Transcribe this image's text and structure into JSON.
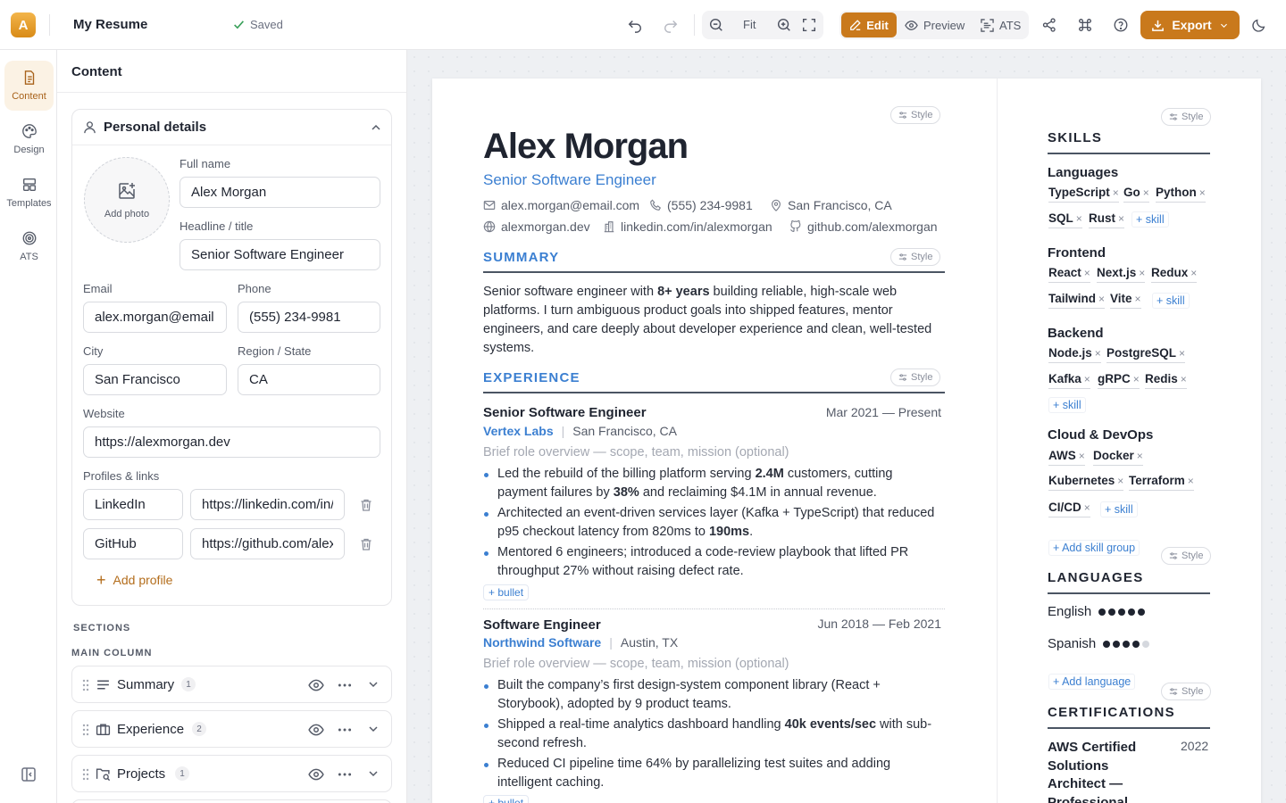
{
  "app": {
    "logo_letter": "A",
    "title": "My Resume",
    "saved_label": "Saved"
  },
  "toolbar": {
    "zoom_fit_label": "Fit",
    "modes": {
      "edit": "Edit",
      "preview": "Preview",
      "ats": "ATS"
    },
    "export_label": "Export",
    "accent": "#c9791c"
  },
  "rail": {
    "items": [
      {
        "label": "Content"
      },
      {
        "label": "Design"
      },
      {
        "label": "Templates"
      },
      {
        "label": "ATS"
      }
    ]
  },
  "panel": {
    "title": "Content",
    "personal": {
      "title": "Personal details",
      "add_photo": "Add photo",
      "full_name": {
        "label": "Full name",
        "value": "Alex Morgan"
      },
      "headline": {
        "label": "Headline / title",
        "value": "Senior Software Engineer"
      },
      "email": {
        "label": "Email",
        "value": "alex.morgan@email.com"
      },
      "phone": {
        "label": "Phone",
        "value": "(555) 234-9981"
      },
      "city": {
        "label": "City",
        "value": "San Francisco"
      },
      "region": {
        "label": "Region / State",
        "value": "CA"
      },
      "website": {
        "label": "Website",
        "value": "https://alexmorgan.dev"
      },
      "profiles_label": "Profiles & links",
      "profiles": [
        {
          "network": "LinkedIn",
          "url": "https://linkedin.com/in/alexmorgan"
        },
        {
          "network": "GitHub",
          "url": "https://github.com/alexmorgan"
        }
      ],
      "add_profile": "Add profile"
    },
    "sections_label": "SECTIONS",
    "main_column_label": "MAIN COLUMN",
    "sections": [
      {
        "name": "Summary",
        "count": "1"
      },
      {
        "name": "Experience",
        "count": "2"
      },
      {
        "name": "Projects",
        "count": "1"
      }
    ]
  },
  "resume": {
    "style_label": "Style",
    "name": "Alex Morgan",
    "headline": "Senior Software Engineer",
    "contact": {
      "email": "alex.morgan@email.com",
      "phone": "(555) 234-9981",
      "location": "San Francisco, CA",
      "website": "alexmorgan.dev",
      "linkedin": "linkedin.com/in/alexmorgan",
      "github": "github.com/alexmorgan"
    },
    "summary": {
      "heading": "SUMMARY",
      "t1": "Senior software engineer with ",
      "b1": "8+ years",
      "t2": " building reliable, high-scale web platforms. I turn ambiguous product goals into shipped features, mentor engineers, and care deeply about developer experience and clean, well-tested systems."
    },
    "experience": {
      "heading": "EXPERIENCE",
      "overview_placeholder": "Brief role overview — scope, team, mission (optional)",
      "add_bullet": "+ bullet",
      "jobs": [
        {
          "title": "Senior Software Engineer",
          "dates": "Mar 2021 — Present",
          "company": "Vertex Labs",
          "location": "San Francisco, CA",
          "b1a": "Led the rebuild of the billing platform serving ",
          "b1b": "2.4M",
          "b1c": " customers, cutting payment failures by ",
          "b1d": "38%",
          "b1e": " and reclaiming $4.1M in annual revenue.",
          "b2a": "Architected an event-driven services layer (Kafka + TypeScript) that reduced p95 checkout latency from 820ms to ",
          "b2b": "190ms",
          "b2c": ".",
          "b3": "Mentored 6 engineers; introduced a code-review playbook that lifted PR throughput 27% without raising defect rate."
        },
        {
          "title": "Software Engineer",
          "dates": "Jun 2018 — Feb 2021",
          "company": "Northwind Software",
          "location": "Austin, TX",
          "b1": "Built the company’s first design-system component library (React + Storybook), adopted by 9 product teams.",
          "b2a": "Shipped a real-time analytics dashboard handling ",
          "b2b": "40k events/sec",
          "b2c": " with sub-second refresh.",
          "b3": "Reduced CI pipeline time 64% by parallelizing test suites and adding intelligent caching."
        }
      ]
    },
    "skills": {
      "heading": "SKILLS",
      "add_skill": "+ skill",
      "add_group": "+ Add skill group",
      "groups": [
        {
          "name": "Languages",
          "items": [
            "TypeScript",
            "Go",
            "Python",
            "SQL",
            "Rust"
          ]
        },
        {
          "name": "Frontend",
          "items": [
            "React",
            "Next.js",
            "Redux",
            "Tailwind",
            "Vite"
          ]
        },
        {
          "name": "Backend",
          "items": [
            "Node.js",
            "PostgreSQL",
            "Kafka",
            "gRPC",
            "Redis"
          ]
        },
        {
          "name": "Cloud & DevOps",
          "items": [
            "AWS",
            "Docker",
            "Kubernetes",
            "Terraform",
            "CI/CD"
          ]
        }
      ]
    },
    "languages": {
      "heading": "LANGUAGES",
      "add_language": "+ Add language",
      "items": [
        {
          "name": "English",
          "level": 5
        },
        {
          "name": "Spanish",
          "level": 4
        }
      ]
    },
    "certifications": {
      "heading": "CERTIFICATIONS",
      "items": [
        {
          "name": "AWS Certified Solutions Architect — Professional",
          "year": "2022"
        }
      ]
    }
  }
}
